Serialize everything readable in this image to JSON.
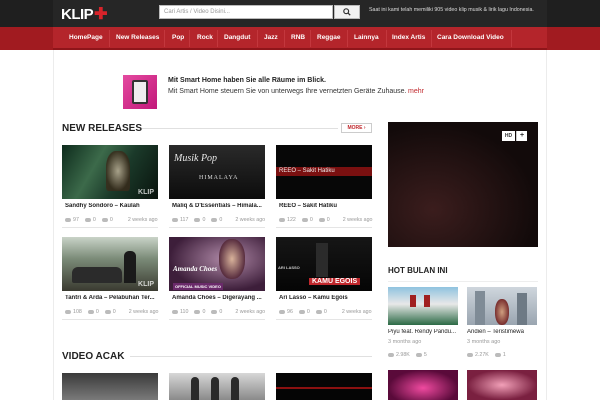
{
  "header": {
    "logo": "KLIP",
    "logo_plus": "✚",
    "search_placeholder": "Cari Artis / Video Disini...",
    "tagline": "Saat ini kami telah memiliki 905 video klip musik & lirik lagu Indonesia."
  },
  "nav": [
    "HomePage",
    "New Releases",
    "Pop",
    "Rock",
    "Dangdut",
    "Jazz",
    "RNB",
    "Reggae",
    "Lainnya",
    "Index Artis",
    "Cara Download Video"
  ],
  "ad": {
    "title": "Mit Smart Home haben Sie alle Räume im Blick.",
    "text": "Mit Smart Home steuern Sie von unterwegs Ihre vernetzten Geräte Zuhause.",
    "link": "mehr"
  },
  "new_releases": {
    "title": "NEW RELEASES",
    "more": "MORE",
    "videos": [
      {
        "title": "Sandhy Sondoro – Kaulah",
        "views": "97",
        "likes": "0",
        "comments": "0",
        "ago": "2 weeks ago",
        "overlay": "KLIP"
      },
      {
        "title": "Maliq & D'Essentials – Himala...",
        "views": "117",
        "likes": "0",
        "comments": "0",
        "ago": "2 weeks ago",
        "overlay": "Musik Pop",
        "overlay2": "HIMALAYA"
      },
      {
        "title": "REEO – Sakit Hatiku",
        "views": "122",
        "likes": "0",
        "comments": "0",
        "ago": "2 weeks ago",
        "overlay": "REEO – Sakit Hatiku"
      },
      {
        "title": "Tantri & Arda – Pelabuhan Ter...",
        "views": "108",
        "likes": "0",
        "comments": "0",
        "ago": "2 weeks ago",
        "overlay": "KLIP"
      },
      {
        "title": "Amanda Choes – Digerayang ...",
        "views": "110",
        "likes": "0",
        "comments": "0",
        "ago": "2 weeks ago",
        "overlay": "Amanda Choes",
        "overlay2": "OFFICIAL MUSIC VIDEO"
      },
      {
        "title": "Ari Lasso – Kamu Egois",
        "views": "96",
        "likes": "0",
        "comments": "0",
        "ago": "2 weeks ago",
        "overlay": "KAMU EGOIS",
        "overlay2": "ARI LASSO"
      }
    ]
  },
  "video_acak": {
    "title": "VIDEO ACAK"
  },
  "sidebar": {
    "hd": "HD",
    "plus": "+",
    "hot_title": "HOT BULAN INI",
    "items": [
      {
        "title": "Piyu feat. Rendy Pandu...",
        "ago": "3 months ago",
        "views": "2.98K",
        "comments": "5"
      },
      {
        "title": "Andien – Teristimewa",
        "ago": "3 months ago",
        "views": "2.27K",
        "comments": "1"
      }
    ]
  }
}
